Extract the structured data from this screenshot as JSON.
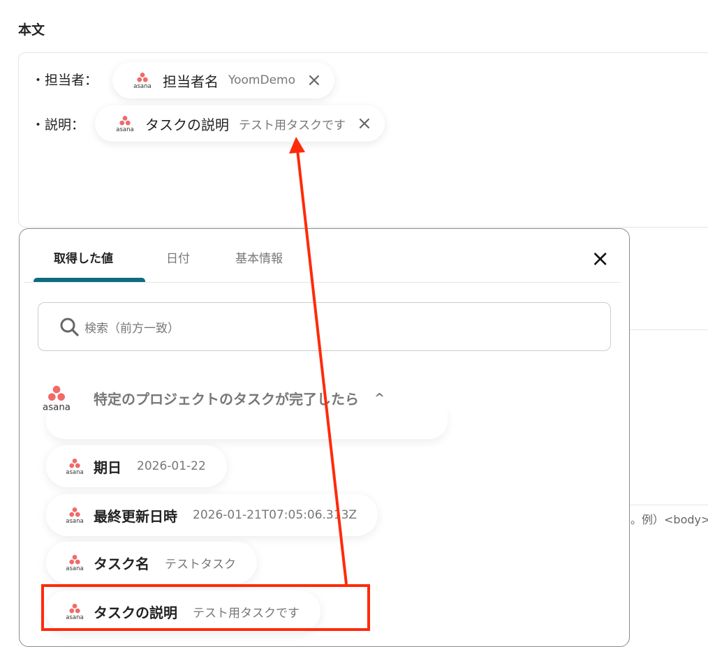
{
  "section_title": "本文",
  "editor": {
    "lines": [
      {
        "label": "・担当者：",
        "chip_key": "担当者名",
        "chip_value": "YoomDemo"
      },
      {
        "label": "・説明：",
        "chip_key": "タスクの説明",
        "chip_value": "テスト用タスクです"
      }
    ],
    "remove_icon": "×"
  },
  "background_hint": "。例）<body>",
  "popup": {
    "tabs": [
      "取得した値",
      "日付",
      "基本情報"
    ],
    "close_icon": "×",
    "search_placeholder": "検索（前方一致）",
    "group_title": "特定のプロジェクトのタスクが完了したら",
    "group_chevron": "^",
    "items": [
      {
        "key": "期日",
        "value": "2026-01-22"
      },
      {
        "key": "最終更新日時",
        "value": "2026-01-21T07:05:06.313Z"
      },
      {
        "key": "タスク名",
        "value": "テストタスク"
      },
      {
        "key": "タスクの説明",
        "value": "テスト用タスクです"
      }
    ]
  },
  "logo_text": "asana",
  "colors": {
    "accent": "#0e6b80",
    "annotation": "#ff2a0a",
    "asana": "#f06a6a"
  }
}
